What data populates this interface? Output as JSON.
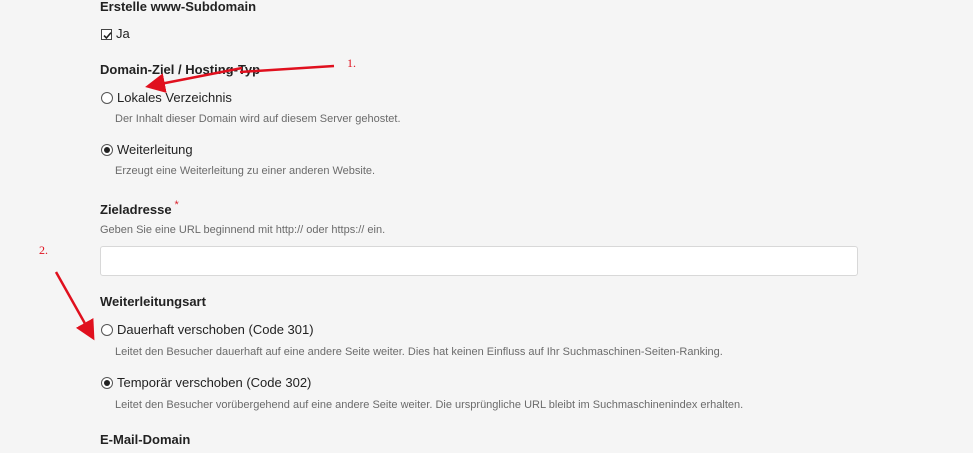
{
  "subdomain": {
    "title": "Erstelle www-Subdomain",
    "checkbox_label": "Ja",
    "checked": true
  },
  "target": {
    "title": "Domain-Ziel / Hosting-Typ",
    "options": [
      {
        "label": "Lokales Verzeichnis",
        "hint": "Der Inhalt dieser Domain wird auf diesem Server gehostet.",
        "checked": false
      },
      {
        "label": "Weiterleitung",
        "hint": "Erzeugt eine Weiterleitung zu einer anderen Website.",
        "checked": true
      }
    ]
  },
  "address": {
    "title": "Zieladresse",
    "required_mark": "*",
    "hint": "Geben Sie eine URL beginnend mit http:// oder https:// ein.",
    "value": ""
  },
  "redirect_type": {
    "title": "Weiterleitungsart",
    "options": [
      {
        "label": "Dauerhaft verschoben (Code 301)",
        "hint": "Leitet den Besucher dauerhaft auf eine andere Seite weiter. Dies hat keinen Einfluss auf Ihr Suchmaschinen-Seiten-Ranking.",
        "checked": false
      },
      {
        "label": "Temporär verschoben (Code 302)",
        "hint": "Leitet den Besucher vorübergehend auf eine andere Seite weiter. Die ursprüngliche URL bleibt im Suchmaschinenindex erhalten.",
        "checked": true
      }
    ]
  },
  "email_domain": {
    "title": "E-Mail-Domain"
  },
  "annotations": {
    "one": "1.",
    "two": "2.",
    "color": "#e0101e"
  }
}
